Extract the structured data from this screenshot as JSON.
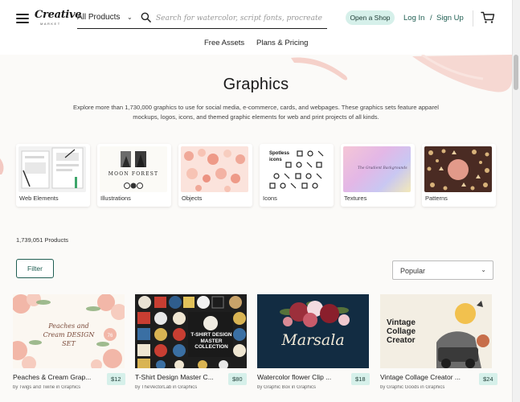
{
  "header": {
    "logo_text": "Creative",
    "logo_sub": "MARKET",
    "category_select": "All Products",
    "search_placeholder": "Search for watercolor, script fonts, procreate",
    "open_shop": "Open a Shop",
    "login": "Log In",
    "slash": "/",
    "signup": "Sign Up"
  },
  "subnav": [
    "Free Assets",
    "Plans & Pricing"
  ],
  "hero": {
    "title": "Graphics",
    "description": "Explore more than 1,730,000 graphics to use for social media, e-commerce, cards, and webpages. These graphics sets feature apparel mockups, logos, icons, and themed graphic elements for web and print projects of all kinds."
  },
  "categories": [
    {
      "label": "Web Elements"
    },
    {
      "label": "Illustrations",
      "thumb_text": "MOON FOREST"
    },
    {
      "label": "Objects"
    },
    {
      "label": "Icons",
      "thumb_text": "Spotless icons"
    },
    {
      "label": "Textures"
    },
    {
      "label": "Patterns"
    }
  ],
  "products_meta": {
    "count": "1,739,051 Products",
    "filter": "Filter",
    "sort": "Popular"
  },
  "products": [
    {
      "title": "Peaches & Cream Grap...",
      "by": "by Twigs and Twine in Graphics",
      "price": "$12",
      "thumb_text": "Peaches and Cream DESIGN SET"
    },
    {
      "title": "T-Shirt Design Master C...",
      "by": "by TheVectorLab in Graphics",
      "price": "$80",
      "thumb_text": "T-SHIRT DESIGN MASTER COLLECTION"
    },
    {
      "title": "Watercolor flower Clip ...",
      "by": "by Graphic Box in Graphics",
      "price": "$18",
      "thumb_text": "Marsala"
    },
    {
      "title": "Vintage Collage Creator ...",
      "by": "by Graphic Goods in Graphics",
      "price": "$24",
      "thumb_text": "Vintage Collage Creator"
    }
  ],
  "colors": {
    "accent": "#1f5e52",
    "accent_light": "#d6f0ea",
    "brush": "#f3c9c2"
  }
}
